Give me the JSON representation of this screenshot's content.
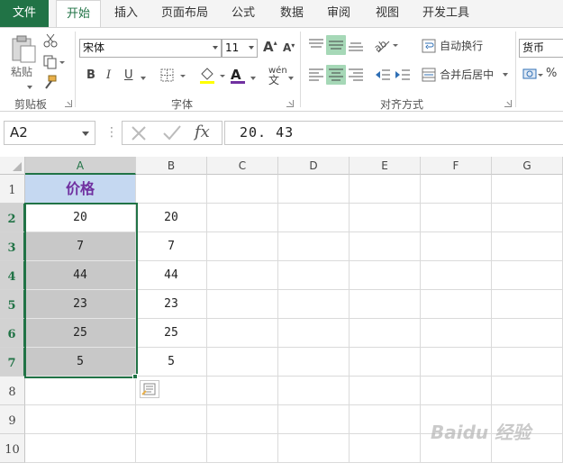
{
  "tabs": [
    "文件",
    "开始",
    "插入",
    "页面布局",
    "公式",
    "数据",
    "审阅",
    "视图",
    "开发工具"
  ],
  "ribbon": {
    "clipboard": {
      "paste_label": "粘贴",
      "group_label": "剪贴板"
    },
    "font": {
      "font_name": "宋体",
      "font_size": "11",
      "bold": "B",
      "italic": "I",
      "underline": "U",
      "font_color_glyph": "A",
      "phonetic_glyph": "wén",
      "grow_glyph": "A",
      "shrink_glyph": "A",
      "group_label": "字体"
    },
    "alignment": {
      "wrap_text": "自动换行",
      "merge_center": "合并后居中",
      "group_label": "对齐方式"
    },
    "number": {
      "format": "货币",
      "percent": "%"
    }
  },
  "formula_bar": {
    "name_box": "A2",
    "fx": "fx",
    "value": "20. 43"
  },
  "columns": [
    "A",
    "B",
    "C",
    "D",
    "E",
    "F",
    "G"
  ],
  "rows": [
    "1",
    "2",
    "3",
    "4",
    "5",
    "6",
    "7",
    "8",
    "9",
    "10"
  ],
  "cells": {
    "A": [
      "价格",
      "20",
      "7",
      "44",
      "23",
      "25",
      "5"
    ],
    "B": [
      "",
      "20",
      "7",
      "44",
      "23",
      "25",
      "5"
    ]
  },
  "watermark": "Baidu 经验",
  "colors": {
    "accent": "#217346",
    "header_fill": "#c5d8f1",
    "header_text": "#7030a0",
    "selection_fill": "#c8c8c8"
  }
}
